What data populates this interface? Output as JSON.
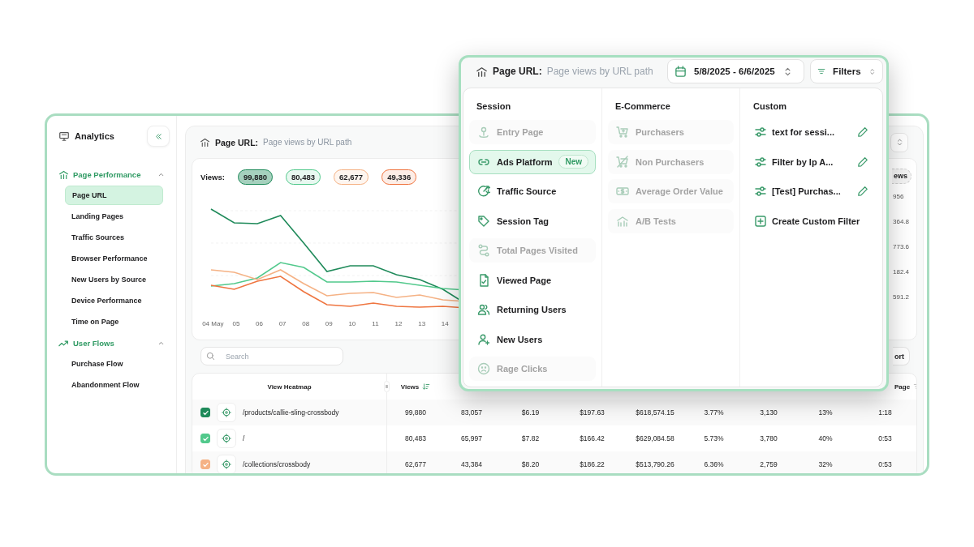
{
  "sidebar": {
    "title": "Analytics",
    "groups": [
      {
        "label": "Page Performance",
        "expanded": true,
        "items": [
          {
            "label": "Page URL",
            "selected": true
          },
          {
            "label": "Landing Pages",
            "selected": false
          },
          {
            "label": "Traffic Sources",
            "selected": false
          },
          {
            "label": "Browser Performance",
            "selected": false
          },
          {
            "label": "New Users by Source",
            "selected": false
          },
          {
            "label": "Device Performance",
            "selected": false
          },
          {
            "label": "Time on Page",
            "selected": false
          }
        ]
      },
      {
        "label": "User Flows",
        "expanded": true,
        "items": [
          {
            "label": "Purchase Flow",
            "selected": false
          },
          {
            "label": "Abandonment Flow",
            "selected": false
          }
        ]
      }
    ]
  },
  "main": {
    "title": "Page URL:",
    "subtitle": "Page views by URL path",
    "views": {
      "label": "Views:",
      "series": [
        {
          "value": "99,880",
          "color": "#1f8a5a"
        },
        {
          "value": "80,483",
          "color": "#52c98c"
        },
        {
          "value": "62,677",
          "color": "#f5b285"
        },
        {
          "value": "49,336",
          "color": "#ef7540"
        }
      ]
    },
    "x_labels": [
      "04 May",
      "05",
      "06",
      "07",
      "08",
      "09",
      "10",
      "11",
      "12",
      "13",
      "14"
    ],
    "axis_fragment": {
      "pill": "ews",
      "labels": [
        "956",
        "364.8",
        "773.6",
        "182.4",
        "591.2"
      ]
    },
    "search": {
      "placeholder": "Search"
    },
    "export_fragment": "ort",
    "table": {
      "columns": {
        "column_1": "View Heatmap",
        "column_2": "Views",
        "column_10": "Page"
      },
      "rows": [
        {
          "checked": true,
          "color": "#1f8a5a",
          "path": "/products/callie-sling-crossbody",
          "values": [
            "99,880",
            "83,057",
            "$6.19",
            "$197.63",
            "$618,574.15",
            "3.77%",
            "3,130",
            "13%",
            "1:18"
          ]
        },
        {
          "checked": true,
          "color": "#52c98c",
          "path": "/",
          "values": [
            "80,483",
            "65,997",
            "$7.82",
            "$166.42",
            "$629,084.58",
            "5.73%",
            "3,780",
            "40%",
            "0:53"
          ]
        },
        {
          "checked": true,
          "color": "#f5b285",
          "path": "/collections/crossbody",
          "values": [
            "62,677",
            "43,384",
            "$8.20",
            "$186.22",
            "$513,790.26",
            "6.36%",
            "2,759",
            "32%",
            "0:53"
          ]
        }
      ]
    }
  },
  "popup": {
    "title": "Page URL:",
    "subtitle": "Page views by URL path",
    "date_range": "5/8/2025 - 6/6/2025",
    "filters": "Filters",
    "columns": [
      {
        "heading": "Session",
        "items": [
          {
            "kind": "filter",
            "label": "Entry Page",
            "disabled": true,
            "selected": false
          },
          {
            "kind": "filter",
            "label": "Ads Platform",
            "disabled": false,
            "selected": true,
            "badge": "New"
          },
          {
            "kind": "filter",
            "label": "Traffic Source",
            "disabled": false,
            "selected": false
          },
          {
            "kind": "filter",
            "label": "Session Tag",
            "disabled": false,
            "selected": false
          },
          {
            "kind": "filter",
            "label": "Total Pages Visited",
            "disabled": true,
            "selected": false
          },
          {
            "kind": "filter",
            "label": "Viewed Page",
            "disabled": false,
            "selected": false
          },
          {
            "kind": "filter",
            "label": "Returning Users",
            "disabled": false,
            "selected": false
          },
          {
            "kind": "filter",
            "label": "New Users",
            "disabled": false,
            "selected": false
          },
          {
            "kind": "filter",
            "label": "Rage Clicks",
            "disabled": true,
            "selected": false
          }
        ]
      },
      {
        "heading": "E-Commerce",
        "items": [
          {
            "kind": "filter",
            "label": "Purchasers",
            "disabled": true,
            "selected": false
          },
          {
            "kind": "filter",
            "label": "Non Purchasers",
            "disabled": true,
            "selected": false
          },
          {
            "kind": "filter",
            "label": "Average Order Value",
            "disabled": true,
            "selected": false
          },
          {
            "kind": "filter",
            "label": "A/B Tests",
            "disabled": true,
            "selected": false
          }
        ]
      },
      {
        "heading": "Custom",
        "items": [
          {
            "kind": "custom",
            "label": "text for sessi...",
            "disabled": false,
            "selected": false
          },
          {
            "kind": "custom",
            "label": "Filter by Ip A...",
            "disabled": false,
            "selected": false
          },
          {
            "kind": "custom",
            "label": "[Test] Purchas...",
            "disabled": false,
            "selected": false
          },
          {
            "kind": "create",
            "label": "Create Custom Filter",
            "disabled": false,
            "selected": false
          }
        ]
      }
    ]
  }
}
